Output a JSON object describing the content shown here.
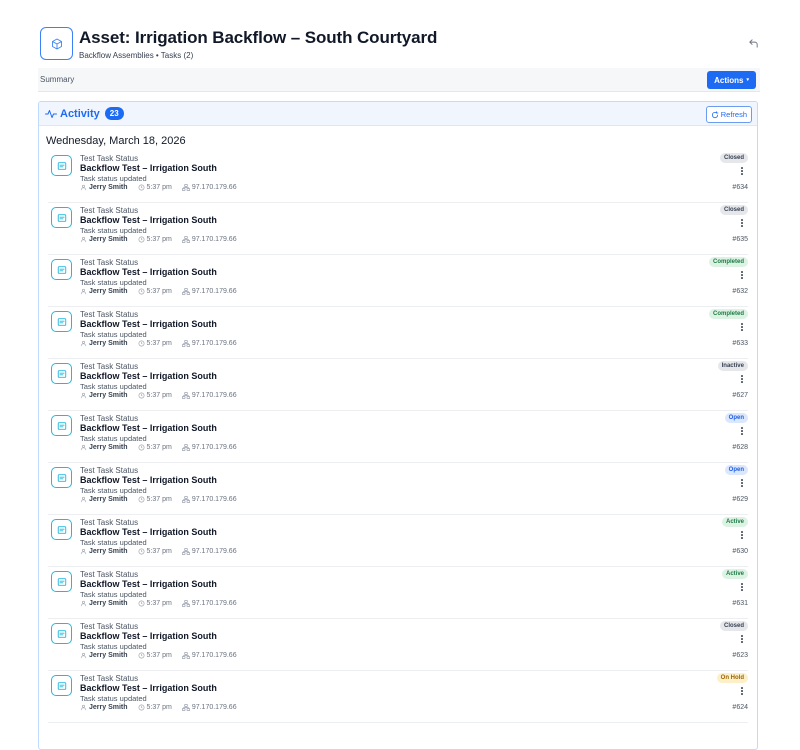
{
  "header": {
    "title": "Asset: Irrigation Backflow – South Courtyard",
    "breadcrumb": "Backflow Assemblies • Tasks (2)",
    "asset_icon": "cube-icon",
    "back_icon": "back-arrow-icon"
  },
  "summary": {
    "label": "Summary",
    "actions_label": "Actions",
    "actions_caret": "▾"
  },
  "activity": {
    "title": "Activity",
    "count": "23",
    "refresh_label": "Refresh",
    "date_heading": "Wednesday, March 18, 2026"
  },
  "colors": {
    "accent": "#1d6bf3",
    "item_icon": "#22b8e0"
  },
  "status_styles": {
    "Closed": {
      "bg": "#e5e7eb",
      "fg": "#374151"
    },
    "Completed": {
      "bg": "#dcf3e4",
      "fg": "#1e7a44"
    },
    "Inactive": {
      "bg": "#e5e7eb",
      "fg": "#374151"
    },
    "Open": {
      "bg": "#dbe7fd",
      "fg": "#1d5fe0"
    },
    "Active": {
      "bg": "#dcf3e4",
      "fg": "#1e7a44"
    },
    "On Hold": {
      "bg": "#fdefc8",
      "fg": "#9a6407"
    }
  },
  "items": [
    {
      "type": "Test Task Status",
      "title": "Backflow Test – Irrigation South",
      "desc": "Task status updated",
      "user": "Jerry Smith",
      "time": "5:37 pm",
      "ip": "97.170.179.66",
      "status": "Closed",
      "id": "#634"
    },
    {
      "type": "Test Task Status",
      "title": "Backflow Test – Irrigation South",
      "desc": "Task status updated",
      "user": "Jerry Smith",
      "time": "5:37 pm",
      "ip": "97.170.179.66",
      "status": "Closed",
      "id": "#635"
    },
    {
      "type": "Test Task Status",
      "title": "Backflow Test – Irrigation South",
      "desc": "Task status updated",
      "user": "Jerry Smith",
      "time": "5:37 pm",
      "ip": "97.170.179.66",
      "status": "Completed",
      "id": "#632"
    },
    {
      "type": "Test Task Status",
      "title": "Backflow Test – Irrigation South",
      "desc": "Task status updated",
      "user": "Jerry Smith",
      "time": "5:37 pm",
      "ip": "97.170.179.66",
      "status": "Completed",
      "id": "#633"
    },
    {
      "type": "Test Task Status",
      "title": "Backflow Test – Irrigation South",
      "desc": "Task status updated",
      "user": "Jerry Smith",
      "time": "5:37 pm",
      "ip": "97.170.179.66",
      "status": "Inactive",
      "id": "#627"
    },
    {
      "type": "Test Task Status",
      "title": "Backflow Test – Irrigation South",
      "desc": "Task status updated",
      "user": "Jerry Smith",
      "time": "5:37 pm",
      "ip": "97.170.179.66",
      "status": "Open",
      "id": "#628"
    },
    {
      "type": "Test Task Status",
      "title": "Backflow Test – Irrigation South",
      "desc": "Task status updated",
      "user": "Jerry Smith",
      "time": "5:37 pm",
      "ip": "97.170.179.66",
      "status": "Open",
      "id": "#629"
    },
    {
      "type": "Test Task Status",
      "title": "Backflow Test – Irrigation South",
      "desc": "Task status updated",
      "user": "Jerry Smith",
      "time": "5:37 pm",
      "ip": "97.170.179.66",
      "status": "Active",
      "id": "#630"
    },
    {
      "type": "Test Task Status",
      "title": "Backflow Test – Irrigation South",
      "desc": "Task status updated",
      "user": "Jerry Smith",
      "time": "5:37 pm",
      "ip": "97.170.179.66",
      "status": "Active",
      "id": "#631"
    },
    {
      "type": "Test Task Status",
      "title": "Backflow Test – Irrigation South",
      "desc": "Task status updated",
      "user": "Jerry Smith",
      "time": "5:37 pm",
      "ip": "97.170.179.66",
      "status": "Closed",
      "id": "#623"
    },
    {
      "type": "Test Task Status",
      "title": "Backflow Test – Irrigation South",
      "desc": "Task status updated",
      "user": "Jerry Smith",
      "time": "5:37 pm",
      "ip": "97.170.179.66",
      "status": "On Hold",
      "id": "#624"
    }
  ]
}
